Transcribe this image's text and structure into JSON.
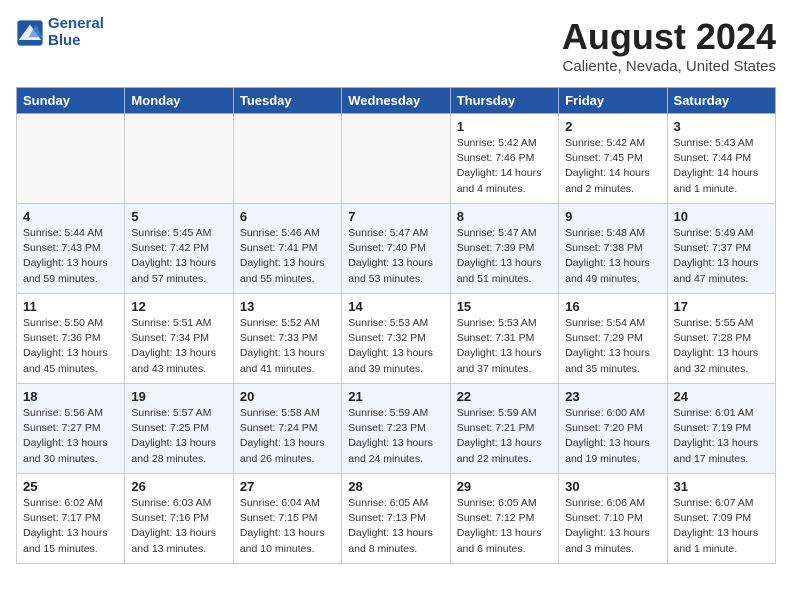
{
  "header": {
    "logo_line1": "General",
    "logo_line2": "Blue",
    "title": "August 2024",
    "location": "Caliente, Nevada, United States"
  },
  "days_of_week": [
    "Sunday",
    "Monday",
    "Tuesday",
    "Wednesday",
    "Thursday",
    "Friday",
    "Saturday"
  ],
  "weeks": [
    [
      {
        "day": "",
        "detail": ""
      },
      {
        "day": "",
        "detail": ""
      },
      {
        "day": "",
        "detail": ""
      },
      {
        "day": "",
        "detail": ""
      },
      {
        "day": "1",
        "detail": "Sunrise: 5:42 AM\nSunset: 7:46 PM\nDaylight: 14 hours\nand 4 minutes."
      },
      {
        "day": "2",
        "detail": "Sunrise: 5:42 AM\nSunset: 7:45 PM\nDaylight: 14 hours\nand 2 minutes."
      },
      {
        "day": "3",
        "detail": "Sunrise: 5:43 AM\nSunset: 7:44 PM\nDaylight: 14 hours\nand 1 minute."
      }
    ],
    [
      {
        "day": "4",
        "detail": "Sunrise: 5:44 AM\nSunset: 7:43 PM\nDaylight: 13 hours\nand 59 minutes."
      },
      {
        "day": "5",
        "detail": "Sunrise: 5:45 AM\nSunset: 7:42 PM\nDaylight: 13 hours\nand 57 minutes."
      },
      {
        "day": "6",
        "detail": "Sunrise: 5:46 AM\nSunset: 7:41 PM\nDaylight: 13 hours\nand 55 minutes."
      },
      {
        "day": "7",
        "detail": "Sunrise: 5:47 AM\nSunset: 7:40 PM\nDaylight: 13 hours\nand 53 minutes."
      },
      {
        "day": "8",
        "detail": "Sunrise: 5:47 AM\nSunset: 7:39 PM\nDaylight: 13 hours\nand 51 minutes."
      },
      {
        "day": "9",
        "detail": "Sunrise: 5:48 AM\nSunset: 7:38 PM\nDaylight: 13 hours\nand 49 minutes."
      },
      {
        "day": "10",
        "detail": "Sunrise: 5:49 AM\nSunset: 7:37 PM\nDaylight: 13 hours\nand 47 minutes."
      }
    ],
    [
      {
        "day": "11",
        "detail": "Sunrise: 5:50 AM\nSunset: 7:36 PM\nDaylight: 13 hours\nand 45 minutes."
      },
      {
        "day": "12",
        "detail": "Sunrise: 5:51 AM\nSunset: 7:34 PM\nDaylight: 13 hours\nand 43 minutes."
      },
      {
        "day": "13",
        "detail": "Sunrise: 5:52 AM\nSunset: 7:33 PM\nDaylight: 13 hours\nand 41 minutes."
      },
      {
        "day": "14",
        "detail": "Sunrise: 5:53 AM\nSunset: 7:32 PM\nDaylight: 13 hours\nand 39 minutes."
      },
      {
        "day": "15",
        "detail": "Sunrise: 5:53 AM\nSunset: 7:31 PM\nDaylight: 13 hours\nand 37 minutes."
      },
      {
        "day": "16",
        "detail": "Sunrise: 5:54 AM\nSunset: 7:29 PM\nDaylight: 13 hours\nand 35 minutes."
      },
      {
        "day": "17",
        "detail": "Sunrise: 5:55 AM\nSunset: 7:28 PM\nDaylight: 13 hours\nand 32 minutes."
      }
    ],
    [
      {
        "day": "18",
        "detail": "Sunrise: 5:56 AM\nSunset: 7:27 PM\nDaylight: 13 hours\nand 30 minutes."
      },
      {
        "day": "19",
        "detail": "Sunrise: 5:57 AM\nSunset: 7:25 PM\nDaylight: 13 hours\nand 28 minutes."
      },
      {
        "day": "20",
        "detail": "Sunrise: 5:58 AM\nSunset: 7:24 PM\nDaylight: 13 hours\nand 26 minutes."
      },
      {
        "day": "21",
        "detail": "Sunrise: 5:59 AM\nSunset: 7:23 PM\nDaylight: 13 hours\nand 24 minutes."
      },
      {
        "day": "22",
        "detail": "Sunrise: 5:59 AM\nSunset: 7:21 PM\nDaylight: 13 hours\nand 22 minutes."
      },
      {
        "day": "23",
        "detail": "Sunrise: 6:00 AM\nSunset: 7:20 PM\nDaylight: 13 hours\nand 19 minutes."
      },
      {
        "day": "24",
        "detail": "Sunrise: 6:01 AM\nSunset: 7:19 PM\nDaylight: 13 hours\nand 17 minutes."
      }
    ],
    [
      {
        "day": "25",
        "detail": "Sunrise: 6:02 AM\nSunset: 7:17 PM\nDaylight: 13 hours\nand 15 minutes."
      },
      {
        "day": "26",
        "detail": "Sunrise: 6:03 AM\nSunset: 7:16 PM\nDaylight: 13 hours\nand 13 minutes."
      },
      {
        "day": "27",
        "detail": "Sunrise: 6:04 AM\nSunset: 7:15 PM\nDaylight: 13 hours\nand 10 minutes."
      },
      {
        "day": "28",
        "detail": "Sunrise: 6:05 AM\nSunset: 7:13 PM\nDaylight: 13 hours\nand 8 minutes."
      },
      {
        "day": "29",
        "detail": "Sunrise: 6:05 AM\nSunset: 7:12 PM\nDaylight: 13 hours\nand 6 minutes."
      },
      {
        "day": "30",
        "detail": "Sunrise: 6:06 AM\nSunset: 7:10 PM\nDaylight: 13 hours\nand 3 minutes."
      },
      {
        "day": "31",
        "detail": "Sunrise: 6:07 AM\nSunset: 7:09 PM\nDaylight: 13 hours\nand 1 minute."
      }
    ]
  ]
}
